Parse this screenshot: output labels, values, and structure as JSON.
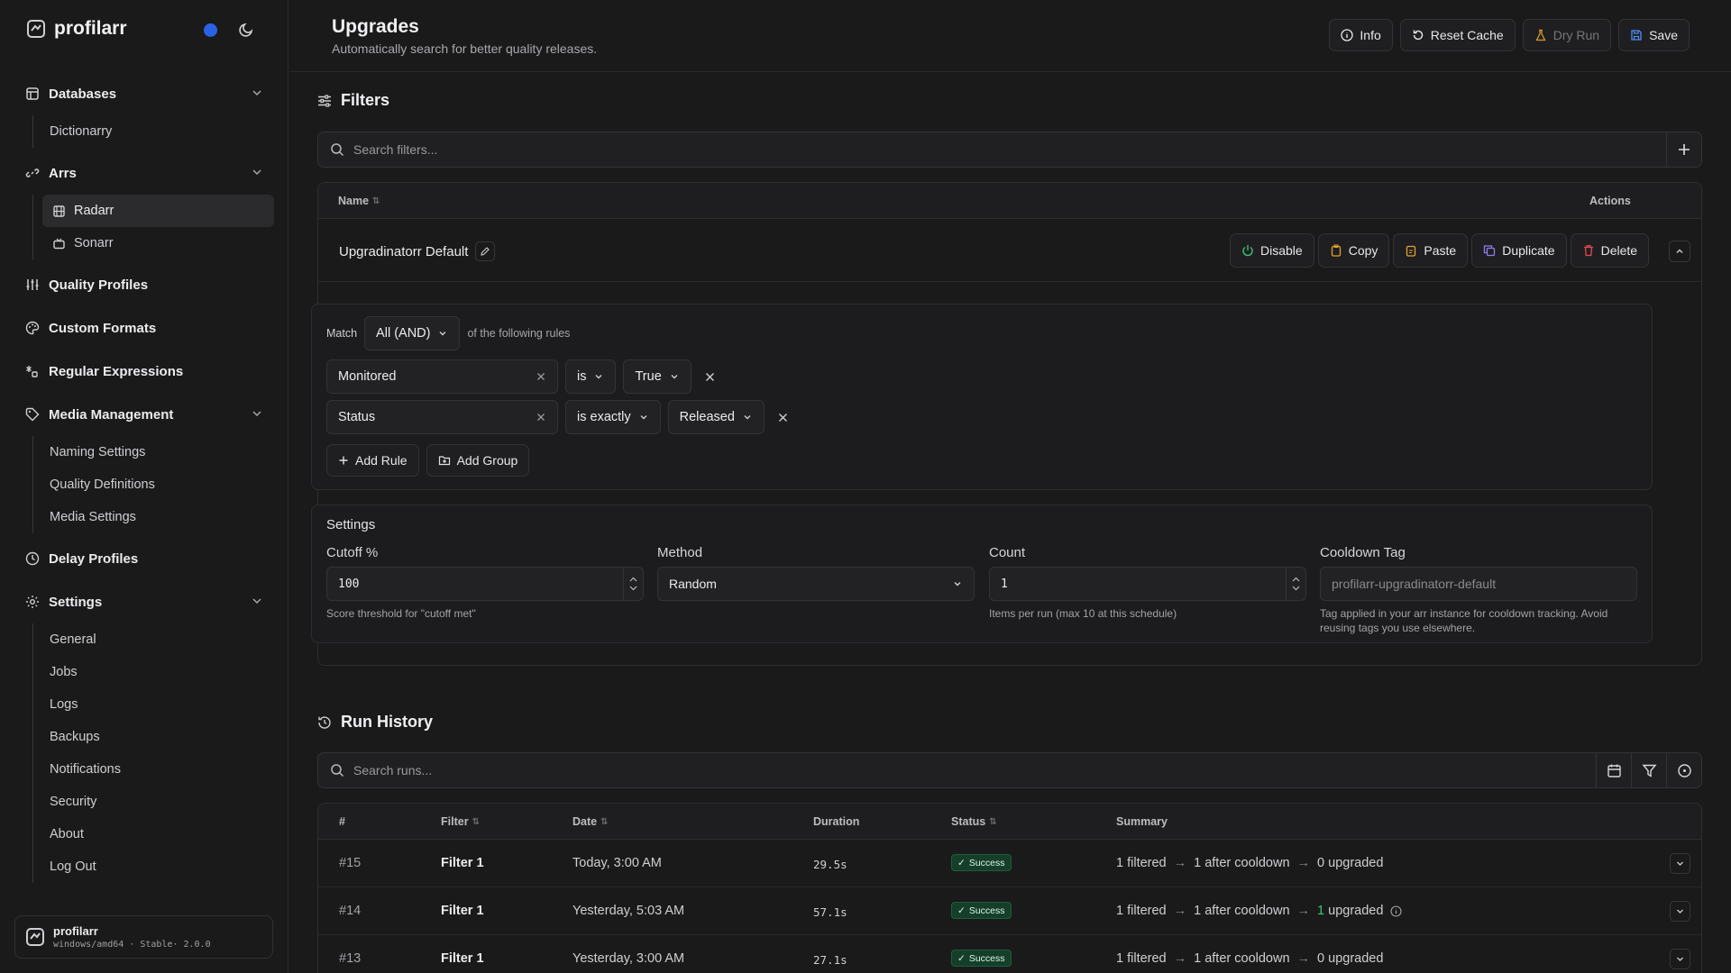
{
  "app": {
    "name": "profilarr",
    "platform": "windows/amd64 · Stable· 2.0.0"
  },
  "sidebar": {
    "groups": [
      {
        "label": "Databases",
        "items": [
          {
            "label": "Dictionarry"
          }
        ]
      },
      {
        "label": "Arrs",
        "items": [
          {
            "label": "Radarr"
          },
          {
            "label": "Sonarr"
          }
        ]
      },
      {
        "label": "Quality Profiles"
      },
      {
        "label": "Custom Formats"
      },
      {
        "label": "Regular Expressions"
      },
      {
        "label": "Media Management",
        "items": [
          {
            "label": "Naming Settings"
          },
          {
            "label": "Quality Definitions"
          },
          {
            "label": "Media Settings"
          }
        ]
      },
      {
        "label": "Delay Profiles"
      },
      {
        "label": "Settings",
        "items": [
          {
            "label": "General"
          },
          {
            "label": "Jobs"
          },
          {
            "label": "Logs"
          },
          {
            "label": "Backups"
          },
          {
            "label": "Notifications"
          },
          {
            "label": "Security"
          },
          {
            "label": "About"
          },
          {
            "label": "Log Out"
          }
        ]
      }
    ]
  },
  "header": {
    "title": "Upgrades",
    "subtitle": "Automatically search for better quality releases.",
    "actions": {
      "info": "Info",
      "reset_cache": "Reset Cache",
      "dry_run": "Dry Run",
      "save": "Save"
    }
  },
  "filters": {
    "title": "Filters",
    "search_placeholder": "Search filters...",
    "columns": {
      "name": "Name",
      "actions": "Actions"
    },
    "row": {
      "name": "Upgradinatorr Default",
      "actions": {
        "disable": "Disable",
        "copy": "Copy",
        "paste": "Paste",
        "duplicate": "Duplicate",
        "delete": "Delete"
      }
    },
    "rules": {
      "match_label": "Match",
      "match_value": "All (AND)",
      "match_suffix": "of the following rules",
      "items": [
        {
          "field": "Monitored",
          "operator": "is",
          "value": "True"
        },
        {
          "field": "Status",
          "operator": "is exactly",
          "value": "Released"
        }
      ],
      "add_rule": "Add Rule",
      "add_group": "Add Group"
    },
    "settings": {
      "title": "Settings",
      "cutoff": {
        "label": "Cutoff %",
        "value": "100",
        "hint": "Score threshold for \"cutoff met\""
      },
      "method": {
        "label": "Method",
        "value": "Random"
      },
      "count": {
        "label": "Count",
        "value": "1",
        "hint": "Items per run (max 10 at this schedule)"
      },
      "cooldown": {
        "label": "Cooldown Tag",
        "placeholder": "profilarr-upgradinatorr-default",
        "hint": "Tag applied in your arr instance for cooldown tracking. Avoid reusing tags you use elsewhere."
      }
    }
  },
  "run_history": {
    "title": "Run History",
    "search_placeholder": "Search runs...",
    "columns": {
      "num": "#",
      "filter": "Filter",
      "date": "Date",
      "duration": "Duration",
      "status": "Status",
      "summary": "Summary"
    },
    "rows": [
      {
        "num": "#15",
        "filter": "Filter 1",
        "date": "Today, 3:00 AM",
        "duration": "29.5s",
        "status": "Success",
        "filtered": "1 filtered",
        "cooldown": "1 after cooldown",
        "upgraded_count": "",
        "upgraded": "0 upgraded"
      },
      {
        "num": "#14",
        "filter": "Filter 1",
        "date": "Yesterday, 5:03 AM",
        "duration": "57.1s",
        "status": "Success",
        "filtered": "1 filtered",
        "cooldown": "1 after cooldown",
        "upgraded_count": "1",
        "upgraded": "upgraded"
      },
      {
        "num": "#13",
        "filter": "Filter 1",
        "date": "Yesterday, 3:00 AM",
        "duration": "27.1s",
        "status": "Success",
        "filtered": "1 filtered",
        "cooldown": "1 after cooldown",
        "upgraded_count": "",
        "upgraded": "0 upgraded"
      }
    ]
  },
  "colors": {
    "accent_dot": "#2a62e4",
    "success": "#42c27d",
    "disable": "#3fbf6f",
    "copy": "#e0a32e",
    "paste": "#e0a32e",
    "duplicate": "#8e7cf0",
    "delete": "#e5484d"
  }
}
